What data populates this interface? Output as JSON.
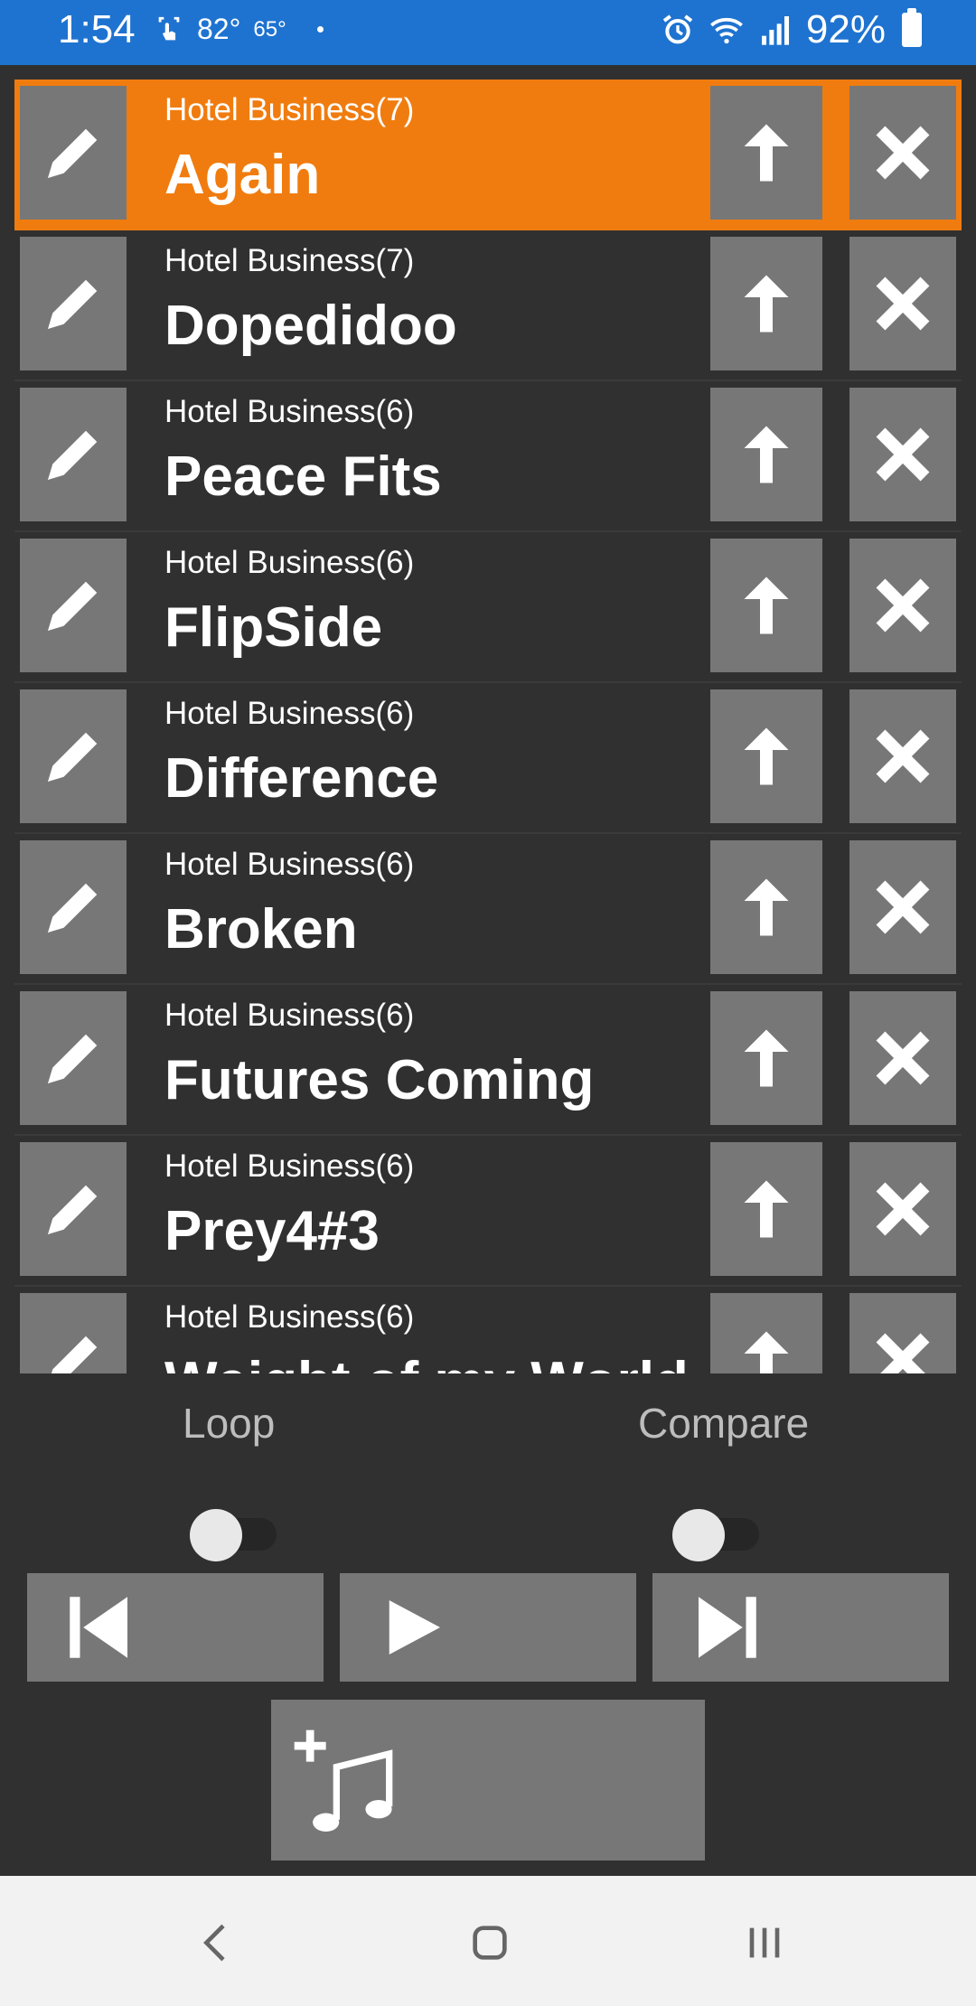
{
  "status_bar": {
    "time": "1:54",
    "temp_high": "82°",
    "temp_low": "65°",
    "battery": "92%",
    "icons": [
      "touch-icon",
      "alarm-icon",
      "wifi-icon",
      "signal-icon",
      "battery-icon"
    ]
  },
  "playlist": {
    "active_color": "#f07c0f",
    "items": [
      {
        "subtitle": "Hotel Business(7)",
        "title": "Again",
        "active": true
      },
      {
        "subtitle": "Hotel Business(7)",
        "title": "Dopedidoo"
      },
      {
        "subtitle": "Hotel Business(6)",
        "title": "Peace Fits"
      },
      {
        "subtitle": "Hotel Business(6)",
        "title": "FlipSide"
      },
      {
        "subtitle": "Hotel Business(6)",
        "title": "Difference"
      },
      {
        "subtitle": "Hotel Business(6)",
        "title": "Broken"
      },
      {
        "subtitle": "Hotel Business(6)",
        "title": "Futures Coming"
      },
      {
        "subtitle": "Hotel Business(6)",
        "title": "Prey4#3"
      },
      {
        "subtitle": "Hotel Business(6)",
        "title": "Weight of my World"
      }
    ]
  },
  "controls": {
    "loop_label": "Loop",
    "compare_label": "Compare",
    "loop_on": false,
    "compare_on": false
  }
}
